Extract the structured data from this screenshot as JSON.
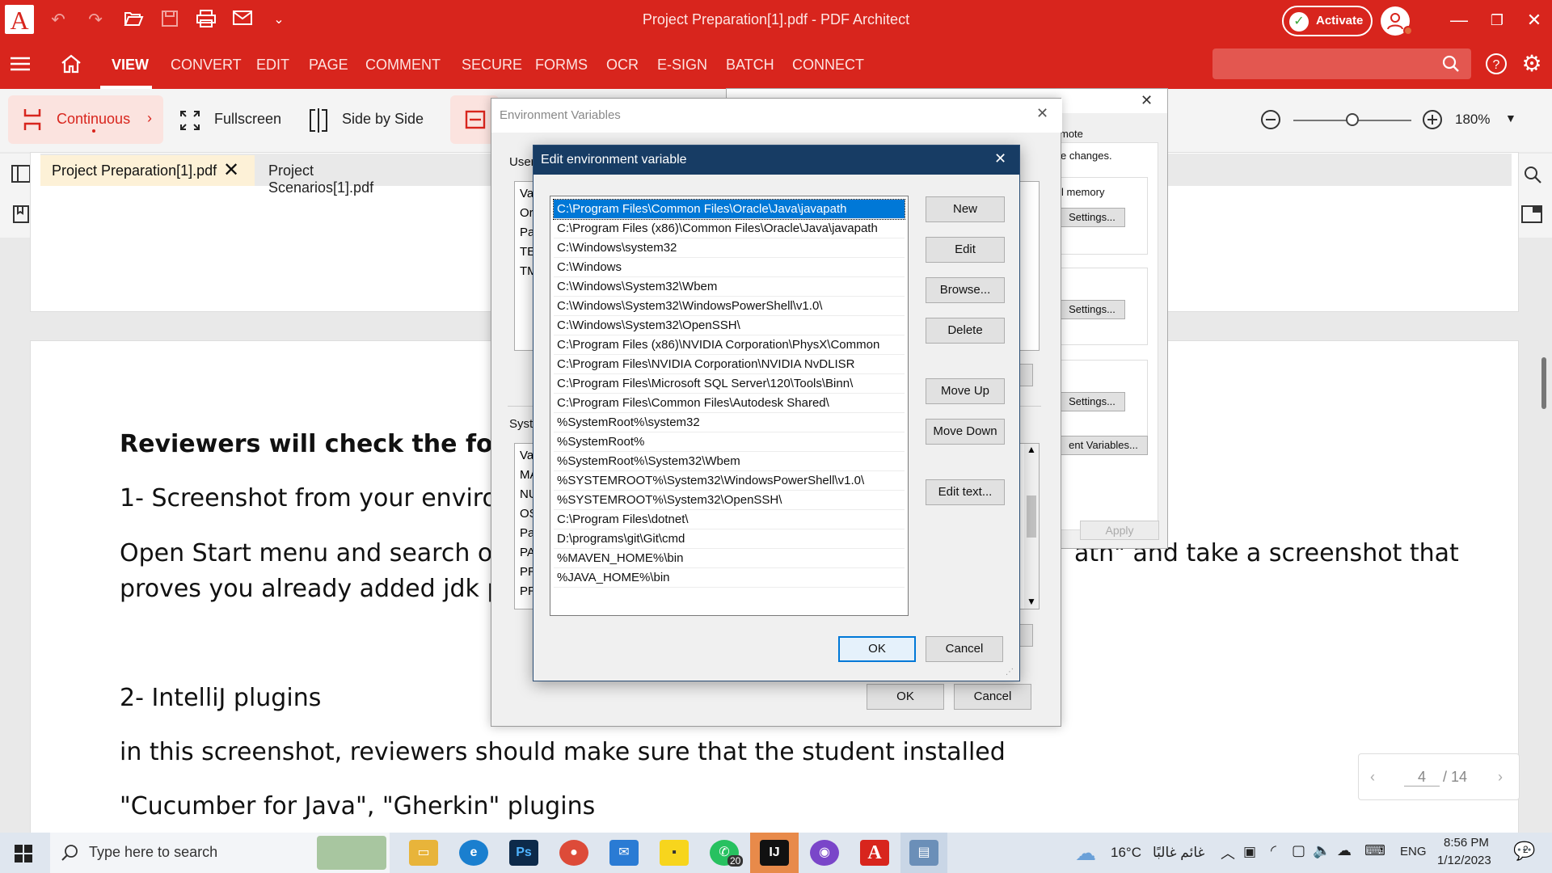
{
  "titlebar": {
    "title": "Project Preparation[1].pdf  -  PDF Architect",
    "activate_label": "Activate",
    "logo_letter": "A"
  },
  "menu": {
    "items": [
      "VIEW",
      "CONVERT",
      "EDIT",
      "PAGE",
      "COMMENT",
      "SECURE",
      "FORMS",
      "OCR",
      "E-SIGN",
      "BATCH",
      "CONNECT"
    ],
    "active": "VIEW"
  },
  "toolbar": {
    "continuous": "Continuous",
    "fullscreen": "Fullscreen",
    "side_by_side": "Side by Side",
    "zoom_value": "180%",
    "zoom_fraction": 0.5
  },
  "tabs": [
    {
      "label": "Project Preparation[1].pdf",
      "active": true
    },
    {
      "label": "Project Scenarios[1].pdf",
      "active": false
    }
  ],
  "document": {
    "line1": "Reviewers will check the followin",
    "line2": "1- Screenshot from your environm",
    "line3a": "Open Start menu and search on \"E",
    "line3b": "ath\" and take a screenshot that",
    "line4": "proves you already added jdk path",
    "line5": "2- IntelliJ plugins",
    "line6": "in this screenshot, reviewers should make sure that the student installed",
    "line7": "\"Cucumber for Java\", \"Gherkin\" plugins"
  },
  "pagenav": {
    "current": "4",
    "total": "/ 14"
  },
  "env_dialog": {
    "title": "Environment Variables",
    "user_label": "User",
    "system_label": "Syste",
    "user_rows": [
      "Va",
      "Or",
      "Pa",
      "TE",
      "TM"
    ],
    "system_rows": [
      "Va",
      "MA",
      "NU",
      "OS",
      "Pa",
      "PA",
      "PR",
      "PR",
      "PR"
    ],
    "ok": "OK",
    "cancel": "Cancel"
  },
  "sys_dialog": {
    "tab_fragment": "mote",
    "changes_fragment": "e changes.",
    "memory_fragment": "l memory",
    "settings": "Settings...",
    "env_vars_fragment": "ent Variables...",
    "apply": "Apply"
  },
  "edit_dialog": {
    "title": "Edit environment variable",
    "paths": [
      "C:\\Program Files\\Common Files\\Oracle\\Java\\javapath",
      "C:\\Program Files (x86)\\Common Files\\Oracle\\Java\\javapath",
      "C:\\Windows\\system32",
      "C:\\Windows",
      "C:\\Windows\\System32\\Wbem",
      "C:\\Windows\\System32\\WindowsPowerShell\\v1.0\\",
      "C:\\Windows\\System32\\OpenSSH\\",
      "C:\\Program Files (x86)\\NVIDIA Corporation\\PhysX\\Common",
      "C:\\Program Files\\NVIDIA Corporation\\NVIDIA NvDLISR",
      "C:\\Program Files\\Microsoft SQL Server\\120\\Tools\\Binn\\",
      "C:\\Program Files\\Common Files\\Autodesk Shared\\",
      "%SystemRoot%\\system32",
      "%SystemRoot%",
      "%SystemRoot%\\System32\\Wbem",
      "%SYSTEMROOT%\\System32\\WindowsPowerShell\\v1.0\\",
      "%SYSTEMROOT%\\System32\\OpenSSH\\",
      "C:\\Program Files\\dotnet\\",
      "D:\\programs\\git\\Git\\cmd",
      "%MAVEN_HOME%\\bin",
      "%JAVA_HOME%\\bin"
    ],
    "selected_index": 0,
    "buttons": {
      "new": "New",
      "edit": "Edit",
      "browse": "Browse...",
      "delete": "Delete",
      "move_up": "Move Up",
      "move_down": "Move Down",
      "edit_text": "Edit text...",
      "ok": "OK",
      "cancel": "Cancel"
    }
  },
  "taskbar": {
    "search_placeholder": "Type here to search",
    "weather": "16°C",
    "weather_desc": "غائم غالبًا",
    "language": "ENG",
    "time": "8:56 PM",
    "date": "1/12/2023",
    "whatsapp_badge": "20",
    "notification_count": "2"
  },
  "colors": {
    "accent": "#d8251d",
    "dialog_title": "#173c64",
    "selection": "#0078d7"
  }
}
